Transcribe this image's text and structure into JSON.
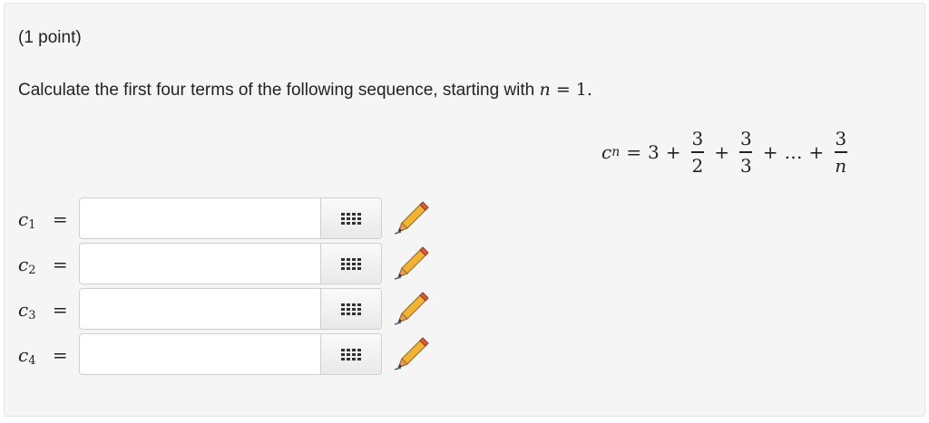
{
  "points_label": "(1 point)",
  "question": {
    "text": "Calculate the first four terms of the following sequence, starting with",
    "var": "n",
    "eq": "=",
    "value": "1",
    "period": "."
  },
  "formula": {
    "lhs_var": "c",
    "lhs_sub": "n",
    "eq": "=",
    "first_term": "3",
    "plus": "+",
    "frac1_num": "3",
    "frac1_den": "2",
    "frac2_num": "3",
    "frac2_den": "3",
    "ellipsis": "…",
    "frac3_num": "3",
    "frac3_den": "n"
  },
  "answers": [
    {
      "var": "c",
      "sub": "1",
      "eq": "=",
      "value": ""
    },
    {
      "var": "c",
      "sub": "2",
      "eq": "=",
      "value": ""
    },
    {
      "var": "c",
      "sub": "3",
      "eq": "=",
      "value": ""
    },
    {
      "var": "c",
      "sub": "4",
      "eq": "=",
      "value": ""
    }
  ],
  "icons": {
    "palette": "grid-icon",
    "edit": "pencil-icon"
  },
  "colors": {
    "panel_bg": "#f5f5f5",
    "pencil_body": "#f2b233",
    "pencil_tip": "#e89a5a",
    "pencil_eraser": "#e05a3a"
  }
}
